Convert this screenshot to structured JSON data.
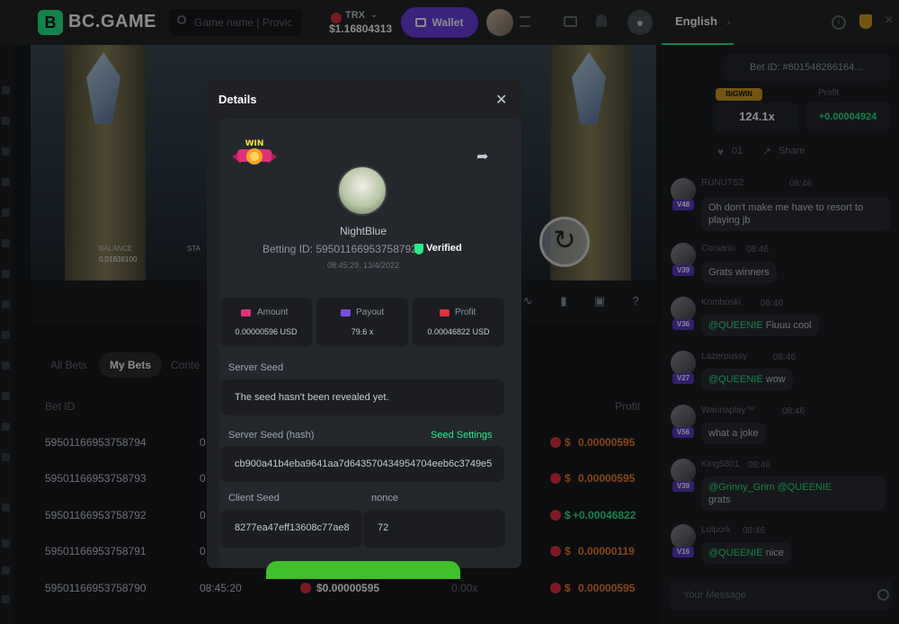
{
  "topbar": {
    "logo_text": "BC.GAME",
    "search_placeholder": "Game name | Provic",
    "currency": "TRX",
    "balance": "$1.16804313",
    "wallet_label": "Wallet",
    "language": "English",
    "logo_mark": "B",
    "info_glyph": "i"
  },
  "game": {
    "balance_label": "BALANCE",
    "balance_value": "0.01838100",
    "stake_label": "STA"
  },
  "bets": {
    "tabs": [
      "All Bets",
      "My Bets",
      "Conte"
    ],
    "col_id": "Bet ID",
    "col_profit": "Profit",
    "rows": [
      {
        "id": "595011669537587​94",
        "time": "0",
        "amount": "0.00000595",
        "color": "#f77d2f"
      },
      {
        "id": "59501166953758793",
        "time": "0",
        "amount": "0.00000595",
        "color": "#f77d2f"
      },
      {
        "id": "59501166953758792",
        "time": "0",
        "amount": "+0.00046822",
        "color": "#24ee89"
      },
      {
        "id": "59501166953758791",
        "time": "0",
        "amount": "0.00000119",
        "color": "#f77d2f"
      },
      {
        "id": "59501166953758790",
        "time": "08:45:20",
        "amount": "0.00000595",
        "color": "#f77d2f"
      }
    ],
    "mid_amount": "$0.00000595",
    "mid_payout": "0.00x"
  },
  "chat": {
    "bet_id": "Bet ID: #601548266164...",
    "bigwin": "BIGWIN",
    "profit_label": "Profit",
    "multiplier": "124.1x",
    "profit_value": "+0.00004924",
    "likes": "01",
    "share": "Share",
    "input_placeholder": "Your Message",
    "messages": [
      {
        "name": "RUNUTS2",
        "time": "08:46",
        "level": "V48",
        "text": "Oh don't make me have to resort to playing jb"
      },
      {
        "name": "Corsario",
        "time": "08:46",
        "level": "V39",
        "text": "Grats winners"
      },
      {
        "name": "Komboski",
        "time": "08:46",
        "level": "V36",
        "mention": "@QUEENIE",
        "text": "Fiuuu cool"
      },
      {
        "name": "Lazerpussy",
        "time": "08:46",
        "level": "V27",
        "mention": "@QUEENIE",
        "text": "wow"
      },
      {
        "name": "Wannaplay™",
        "time": "08:46",
        "level": "V56",
        "text": "what a joke"
      },
      {
        "name": "King5801",
        "time": "08:46",
        "level": "V39",
        "mention": "@Grinny_Grim @QUEENIE",
        "text": "grats"
      },
      {
        "name": "Lolpork",
        "time": "08:46",
        "level": "V16",
        "mention": "@QUEENIE",
        "text": "nice"
      }
    ]
  },
  "modal": {
    "title": "Details",
    "win_badge": "WIN",
    "username": "NightBlue",
    "betting_id": "Betting ID: 59501166953758792",
    "verified": "Verified",
    "date": "08:45:29, 13/4/2022",
    "amount_label": "Amount",
    "amount_value": "0.00000596 USD",
    "payout_label": "Payout",
    "payout_value": "79.6 x",
    "profit_label": "Profit",
    "profit_value": "0.00046822 USD",
    "server_seed_label": "Server Seed",
    "server_seed_value": "The seed hasn't been revealed yet.",
    "hash_label": "Server Seed (hash)",
    "seed_settings": "Seed Settings",
    "hash_value": "cb900a41b4eba9641aa7d643570434954704eeb6c3749e5",
    "client_seed_label": "Client Seed",
    "client_seed_value": "8277ea47eff13608c77ae8",
    "nonce_label": "nonce",
    "nonce_value": "72"
  },
  "colors": {
    "accent": "#24ee89",
    "wallet": "#6b3ee3",
    "loss": "#f77d2f",
    "trx": "#e62e3f",
    "level": "#5a3ac8"
  }
}
